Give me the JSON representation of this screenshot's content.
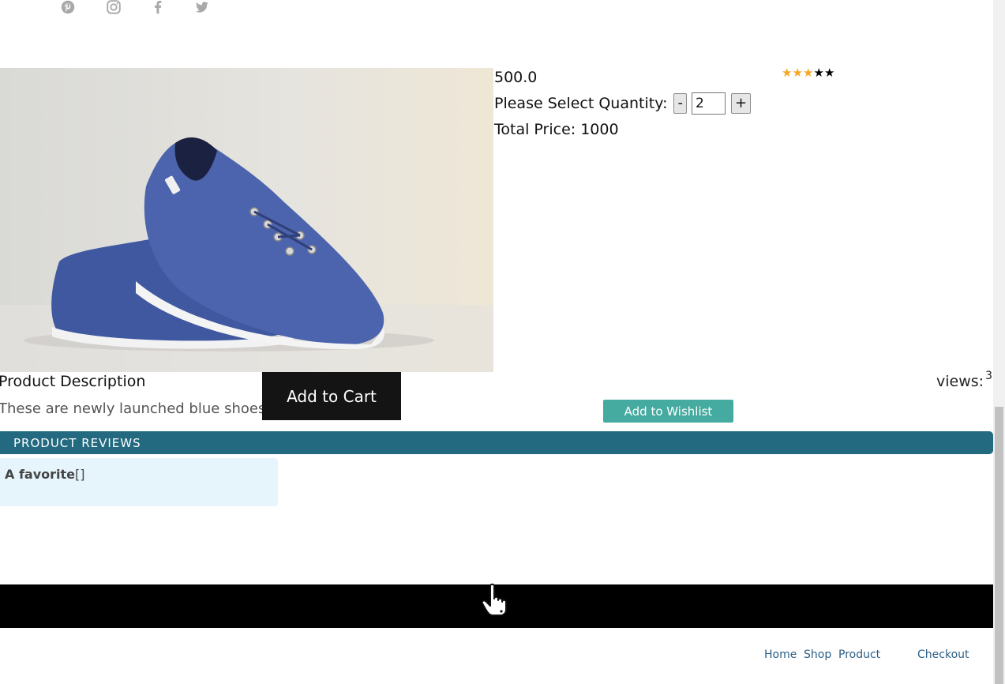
{
  "social": [
    "pinterest-icon",
    "instagram-icon",
    "facebook-icon",
    "twitter-icon"
  ],
  "product": {
    "price": "500.0",
    "quantity_label": "Please Select Quantity:",
    "minus_label": "-",
    "quantity_value": "2",
    "plus_label": "+",
    "total_label": "Total Price: 1000",
    "rating": 3,
    "rating_max": 5,
    "description_title": "Product Description",
    "description_text": "These are newly launched blue shoes.",
    "add_to_cart": "Add to Cart",
    "views_label": "views:",
    "views_count": "3",
    "add_to_wishlist": "Add to Wishlist"
  },
  "reviews": {
    "title": "PRODUCT REVIEWS",
    "items": [
      {
        "title": "A favorite",
        "tags": "[]"
      }
    ]
  },
  "footer": {
    "links": [
      "Home",
      "Shop",
      "Product",
      "Checkout"
    ]
  },
  "colors": {
    "accent_teal": "#45aba0",
    "reviews_bar": "#236a80",
    "star_on": "#f5a623",
    "link": "#2c5f86"
  }
}
